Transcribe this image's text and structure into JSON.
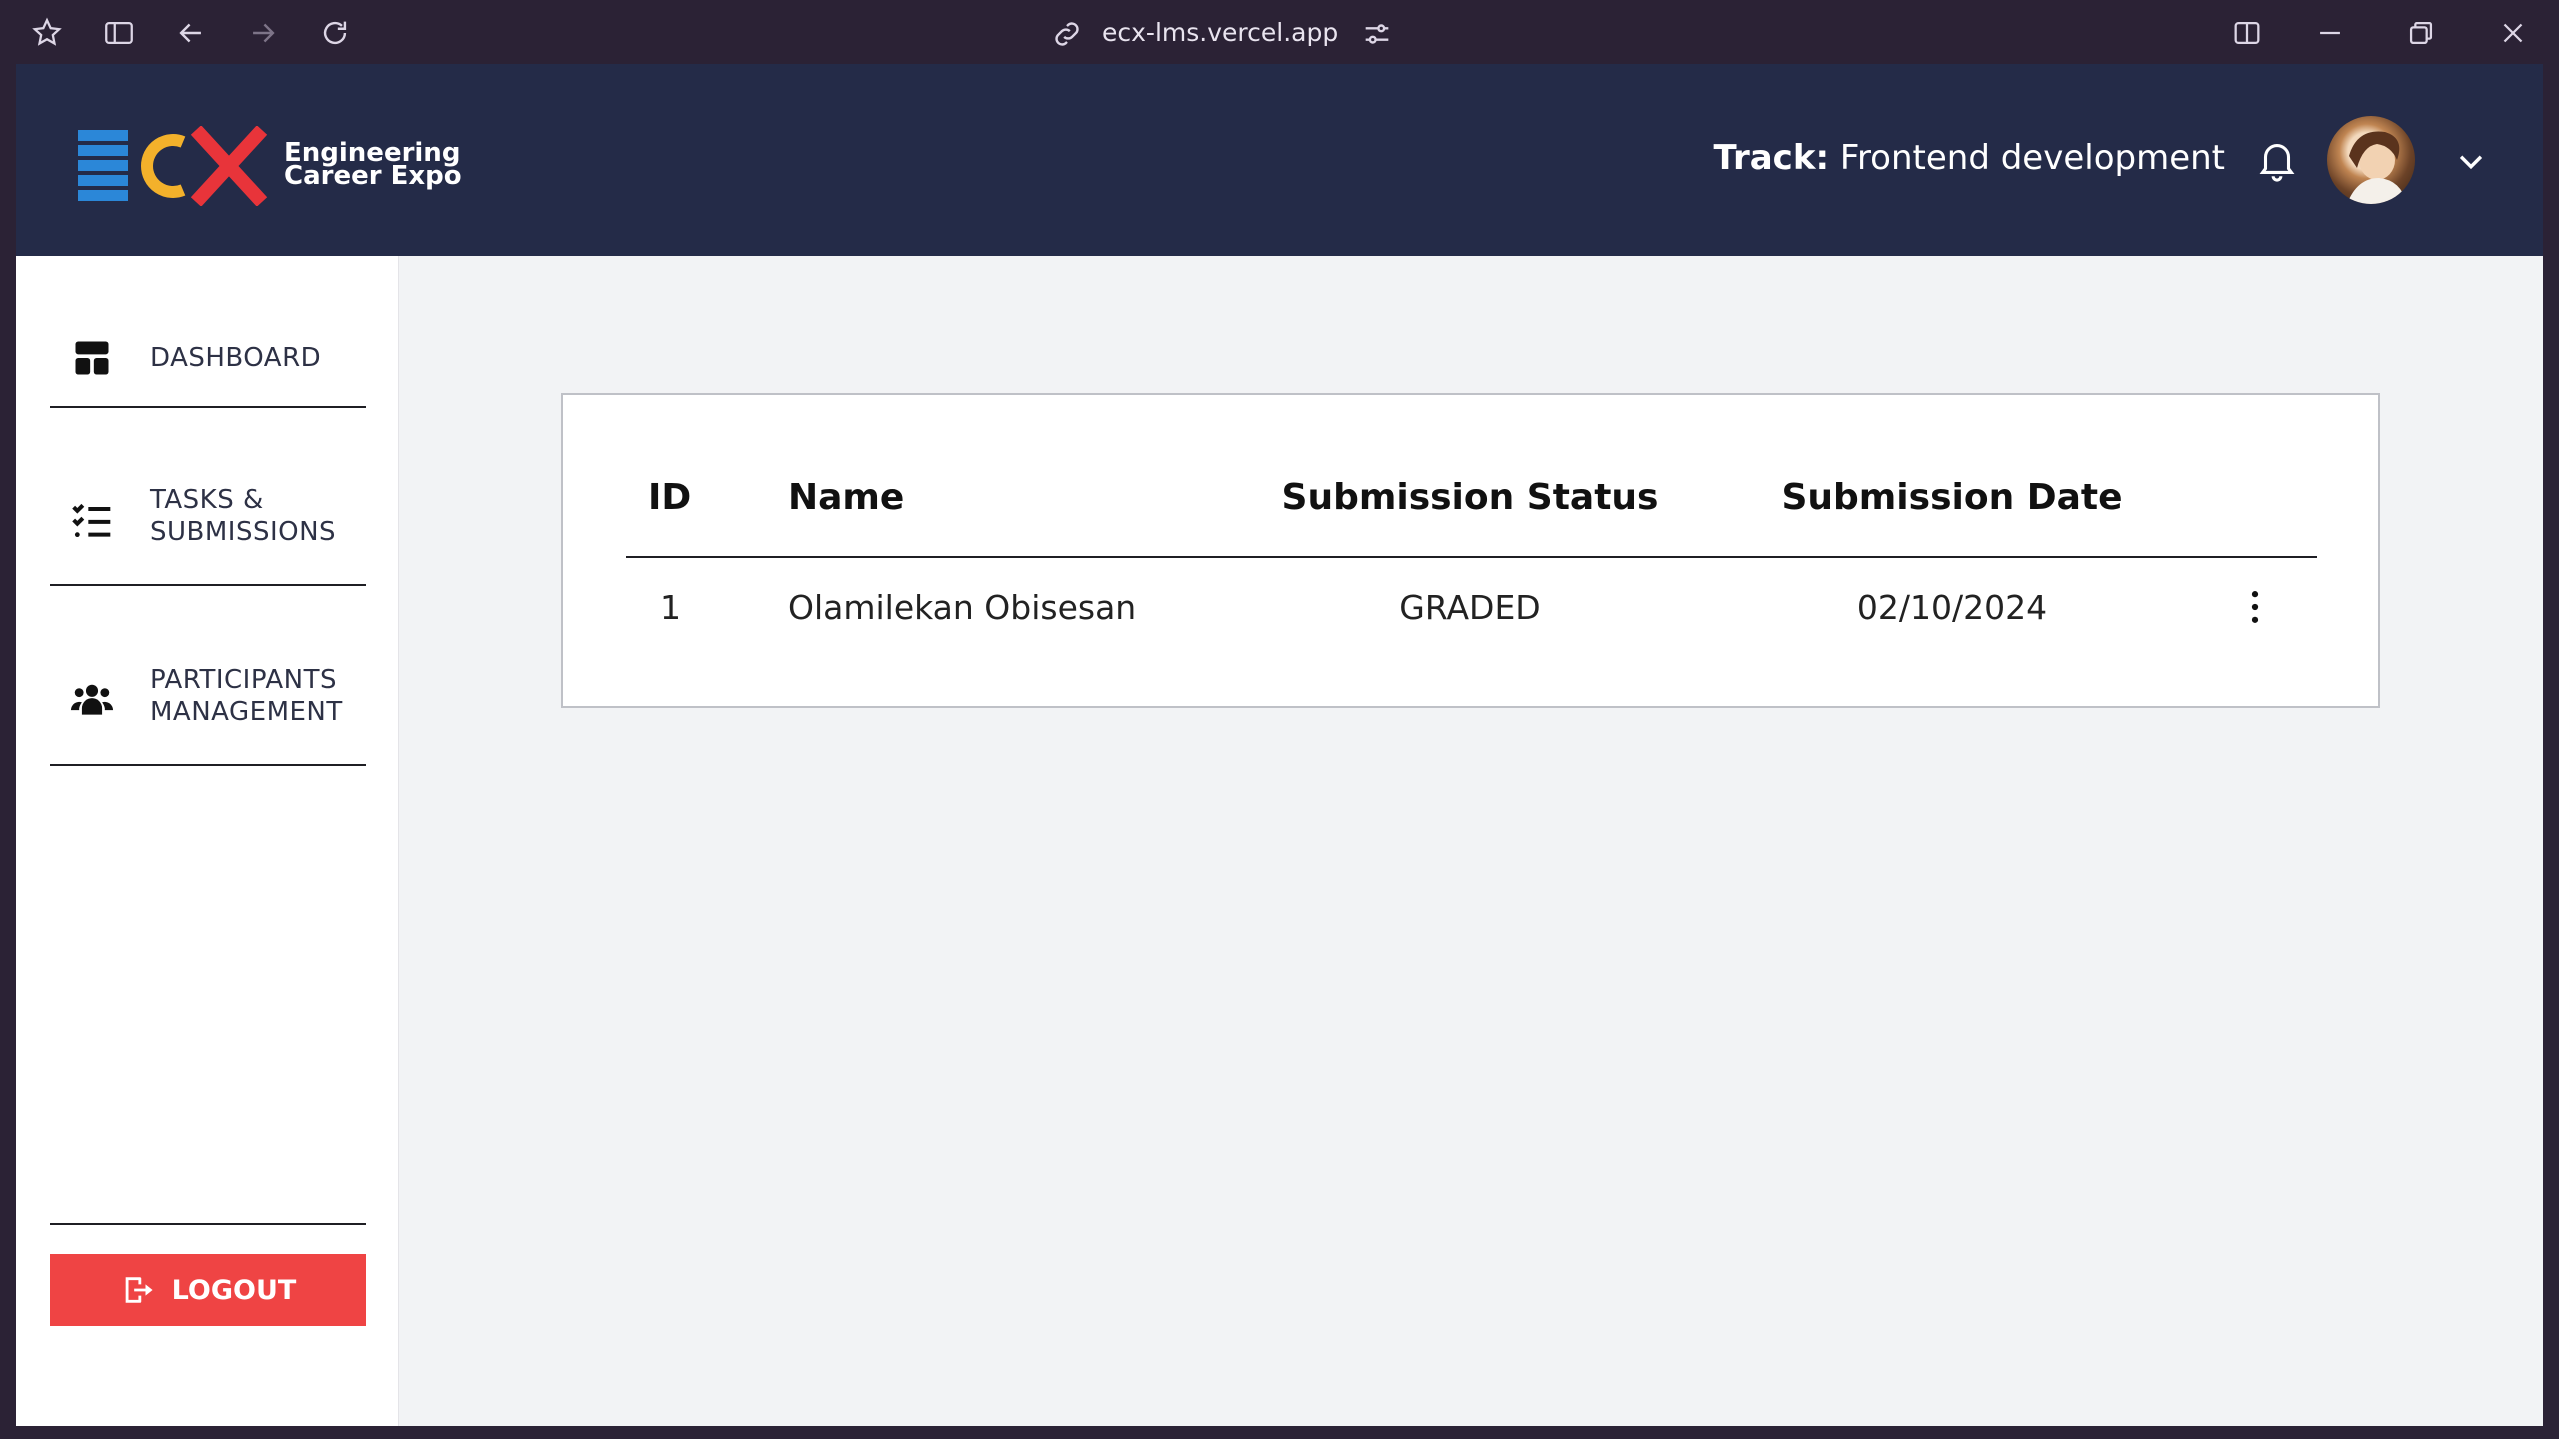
{
  "browser": {
    "url": "ecx-lms.vercel.app",
    "icons": [
      "app-logo-icon",
      "sidebar-toggle-icon",
      "back-icon",
      "forward-icon",
      "reload-icon",
      "link-icon",
      "tune-icon",
      "split-view-icon",
      "minimize-icon",
      "restore-icon",
      "close-icon"
    ]
  },
  "header": {
    "logo_line1": "Engineering",
    "logo_line2": "Career Expo",
    "track_label": "Track:",
    "track_value": "Frontend development",
    "colors": {
      "bar": "#242b48",
      "logo_blue": "#2b87d8",
      "logo_yellow": "#f3b12b",
      "logo_red": "#e8343a"
    }
  },
  "sidebar": {
    "items": [
      {
        "label_line1": "DASHBOARD",
        "label_line2": "",
        "icon": "dashboard-icon"
      },
      {
        "label_line1": "TASKS &",
        "label_line2": "SUBMISSIONS",
        "icon": "task-list-icon"
      },
      {
        "label_line1": "PARTICIPANTS",
        "label_line2": "MANAGEMENT",
        "icon": "users-group-icon"
      }
    ],
    "logout_label": "LOGOUT",
    "logout_color": "#ef4444"
  },
  "table": {
    "headers": [
      "ID",
      "Name",
      "Submission Status",
      "Submission Date"
    ],
    "rows": [
      {
        "id": "1",
        "name": "Olamilekan Obisesan",
        "status": "GRADED",
        "date": "02/10/2024"
      }
    ]
  }
}
